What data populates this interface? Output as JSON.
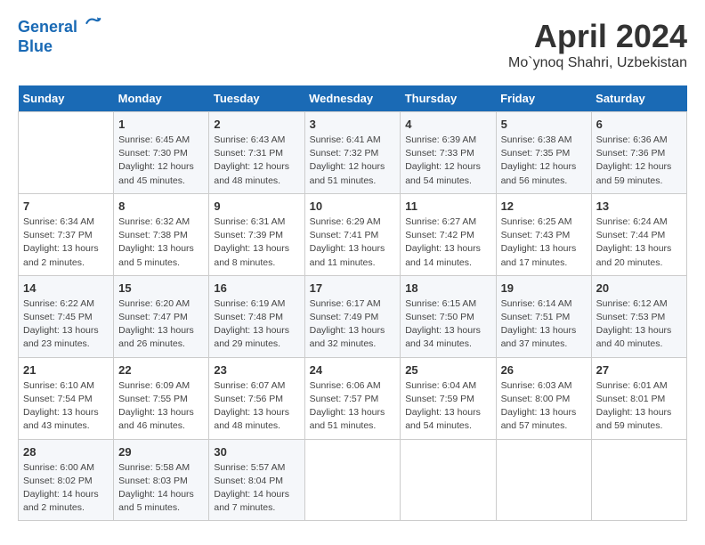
{
  "header": {
    "logo_line1": "General",
    "logo_line2": "Blue",
    "title": "April 2024",
    "location": "Mo`ynoq Shahri, Uzbekistan"
  },
  "weekdays": [
    "Sunday",
    "Monday",
    "Tuesday",
    "Wednesday",
    "Thursday",
    "Friday",
    "Saturday"
  ],
  "weeks": [
    [
      {
        "day": "",
        "info": ""
      },
      {
        "day": "1",
        "info": "Sunrise: 6:45 AM\nSunset: 7:30 PM\nDaylight: 12 hours\nand 45 minutes."
      },
      {
        "day": "2",
        "info": "Sunrise: 6:43 AM\nSunset: 7:31 PM\nDaylight: 12 hours\nand 48 minutes."
      },
      {
        "day": "3",
        "info": "Sunrise: 6:41 AM\nSunset: 7:32 PM\nDaylight: 12 hours\nand 51 minutes."
      },
      {
        "day": "4",
        "info": "Sunrise: 6:39 AM\nSunset: 7:33 PM\nDaylight: 12 hours\nand 54 minutes."
      },
      {
        "day": "5",
        "info": "Sunrise: 6:38 AM\nSunset: 7:35 PM\nDaylight: 12 hours\nand 56 minutes."
      },
      {
        "day": "6",
        "info": "Sunrise: 6:36 AM\nSunset: 7:36 PM\nDaylight: 12 hours\nand 59 minutes."
      }
    ],
    [
      {
        "day": "7",
        "info": "Sunrise: 6:34 AM\nSunset: 7:37 PM\nDaylight: 13 hours\nand 2 minutes."
      },
      {
        "day": "8",
        "info": "Sunrise: 6:32 AM\nSunset: 7:38 PM\nDaylight: 13 hours\nand 5 minutes."
      },
      {
        "day": "9",
        "info": "Sunrise: 6:31 AM\nSunset: 7:39 PM\nDaylight: 13 hours\nand 8 minutes."
      },
      {
        "day": "10",
        "info": "Sunrise: 6:29 AM\nSunset: 7:41 PM\nDaylight: 13 hours\nand 11 minutes."
      },
      {
        "day": "11",
        "info": "Sunrise: 6:27 AM\nSunset: 7:42 PM\nDaylight: 13 hours\nand 14 minutes."
      },
      {
        "day": "12",
        "info": "Sunrise: 6:25 AM\nSunset: 7:43 PM\nDaylight: 13 hours\nand 17 minutes."
      },
      {
        "day": "13",
        "info": "Sunrise: 6:24 AM\nSunset: 7:44 PM\nDaylight: 13 hours\nand 20 minutes."
      }
    ],
    [
      {
        "day": "14",
        "info": "Sunrise: 6:22 AM\nSunset: 7:45 PM\nDaylight: 13 hours\nand 23 minutes."
      },
      {
        "day": "15",
        "info": "Sunrise: 6:20 AM\nSunset: 7:47 PM\nDaylight: 13 hours\nand 26 minutes."
      },
      {
        "day": "16",
        "info": "Sunrise: 6:19 AM\nSunset: 7:48 PM\nDaylight: 13 hours\nand 29 minutes."
      },
      {
        "day": "17",
        "info": "Sunrise: 6:17 AM\nSunset: 7:49 PM\nDaylight: 13 hours\nand 32 minutes."
      },
      {
        "day": "18",
        "info": "Sunrise: 6:15 AM\nSunset: 7:50 PM\nDaylight: 13 hours\nand 34 minutes."
      },
      {
        "day": "19",
        "info": "Sunrise: 6:14 AM\nSunset: 7:51 PM\nDaylight: 13 hours\nand 37 minutes."
      },
      {
        "day": "20",
        "info": "Sunrise: 6:12 AM\nSunset: 7:53 PM\nDaylight: 13 hours\nand 40 minutes."
      }
    ],
    [
      {
        "day": "21",
        "info": "Sunrise: 6:10 AM\nSunset: 7:54 PM\nDaylight: 13 hours\nand 43 minutes."
      },
      {
        "day": "22",
        "info": "Sunrise: 6:09 AM\nSunset: 7:55 PM\nDaylight: 13 hours\nand 46 minutes."
      },
      {
        "day": "23",
        "info": "Sunrise: 6:07 AM\nSunset: 7:56 PM\nDaylight: 13 hours\nand 48 minutes."
      },
      {
        "day": "24",
        "info": "Sunrise: 6:06 AM\nSunset: 7:57 PM\nDaylight: 13 hours\nand 51 minutes."
      },
      {
        "day": "25",
        "info": "Sunrise: 6:04 AM\nSunset: 7:59 PM\nDaylight: 13 hours\nand 54 minutes."
      },
      {
        "day": "26",
        "info": "Sunrise: 6:03 AM\nSunset: 8:00 PM\nDaylight: 13 hours\nand 57 minutes."
      },
      {
        "day": "27",
        "info": "Sunrise: 6:01 AM\nSunset: 8:01 PM\nDaylight: 13 hours\nand 59 minutes."
      }
    ],
    [
      {
        "day": "28",
        "info": "Sunrise: 6:00 AM\nSunset: 8:02 PM\nDaylight: 14 hours\nand 2 minutes."
      },
      {
        "day": "29",
        "info": "Sunrise: 5:58 AM\nSunset: 8:03 PM\nDaylight: 14 hours\nand 5 minutes."
      },
      {
        "day": "30",
        "info": "Sunrise: 5:57 AM\nSunset: 8:04 PM\nDaylight: 14 hours\nand 7 minutes."
      },
      {
        "day": "",
        "info": ""
      },
      {
        "day": "",
        "info": ""
      },
      {
        "day": "",
        "info": ""
      },
      {
        "day": "",
        "info": ""
      }
    ]
  ]
}
